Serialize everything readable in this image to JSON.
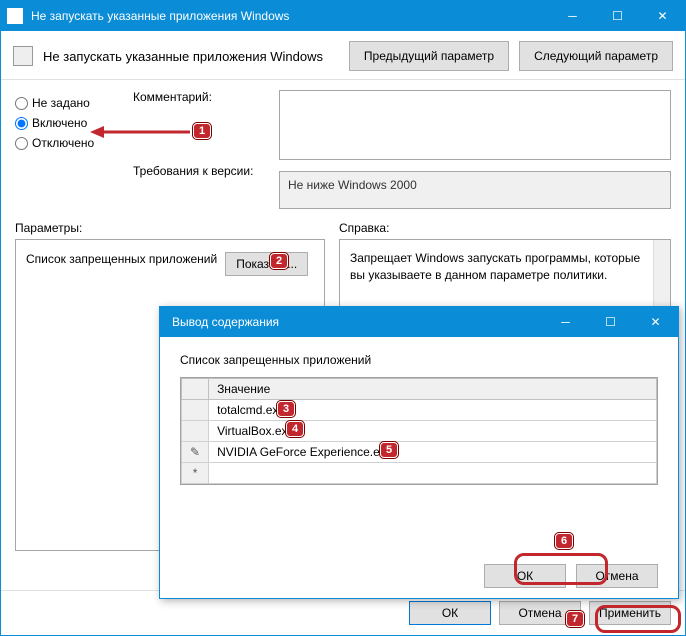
{
  "main": {
    "title": "Не запускать указанные приложения Windows",
    "heading": "Не запускать указанные приложения Windows",
    "prev_btn": "Предыдущий параметр",
    "next_btn": "Следующий параметр",
    "radio": {
      "not_set": "Не задано",
      "enabled": "Включено",
      "disabled": "Отключено"
    },
    "comment_label": "Комментарий:",
    "requirements_label": "Требования к версии:",
    "requirements_value": "Не ниже Windows 2000",
    "params_label": "Параметры:",
    "help_label": "Справка:",
    "params_text": "Список запрещенных приложений",
    "show_btn": "Показать...",
    "help_text": "Запрещает Windows запускать программы, которые вы указываете в данном параметре политики.",
    "footer": {
      "ok": "ОК",
      "cancel": "Отмена",
      "apply": "Применить"
    }
  },
  "modal": {
    "title": "Вывод содержания",
    "label": "Список запрещенных приложений",
    "col_header": "Значение",
    "rows": [
      "totalcmd.exe",
      "VirtualBox.exe",
      "NVIDIA GeForce Experience.exe"
    ],
    "ok": "ОК",
    "cancel": "Отмена"
  },
  "annotations": [
    "1",
    "2",
    "3",
    "4",
    "5",
    "6",
    "7"
  ]
}
